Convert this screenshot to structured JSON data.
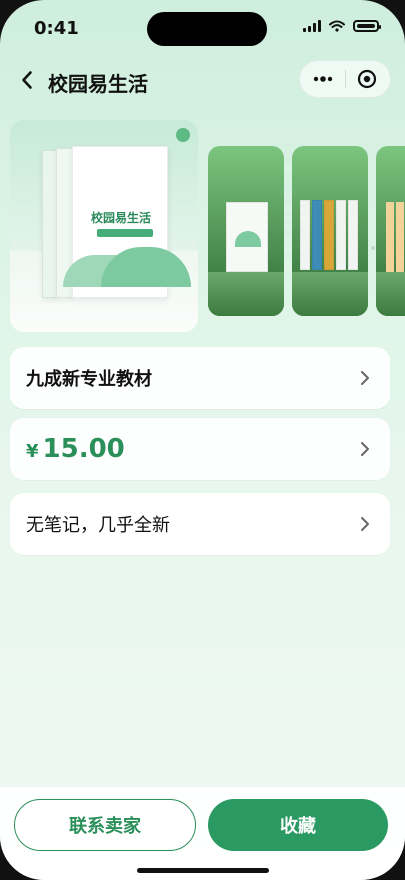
{
  "status": {
    "time": "0:41"
  },
  "nav": {
    "title": "校园易生活"
  },
  "gallery": {
    "main_book_title": "校园易生活"
  },
  "item": {
    "name": "九成新专业教材",
    "price_currency": "¥",
    "price_value": "15.00",
    "condition": "无笔记，几乎全新"
  },
  "actions": {
    "contact_label": "联系卖家",
    "favorite_label": "收藏"
  },
  "colors": {
    "accent_green": "#2b9a62",
    "price_green": "#2b8f5a"
  },
  "icons": {
    "back": "chevron-left-icon",
    "more": "more-icon",
    "target": "target-icon",
    "chevron": "chevron-right-icon"
  }
}
